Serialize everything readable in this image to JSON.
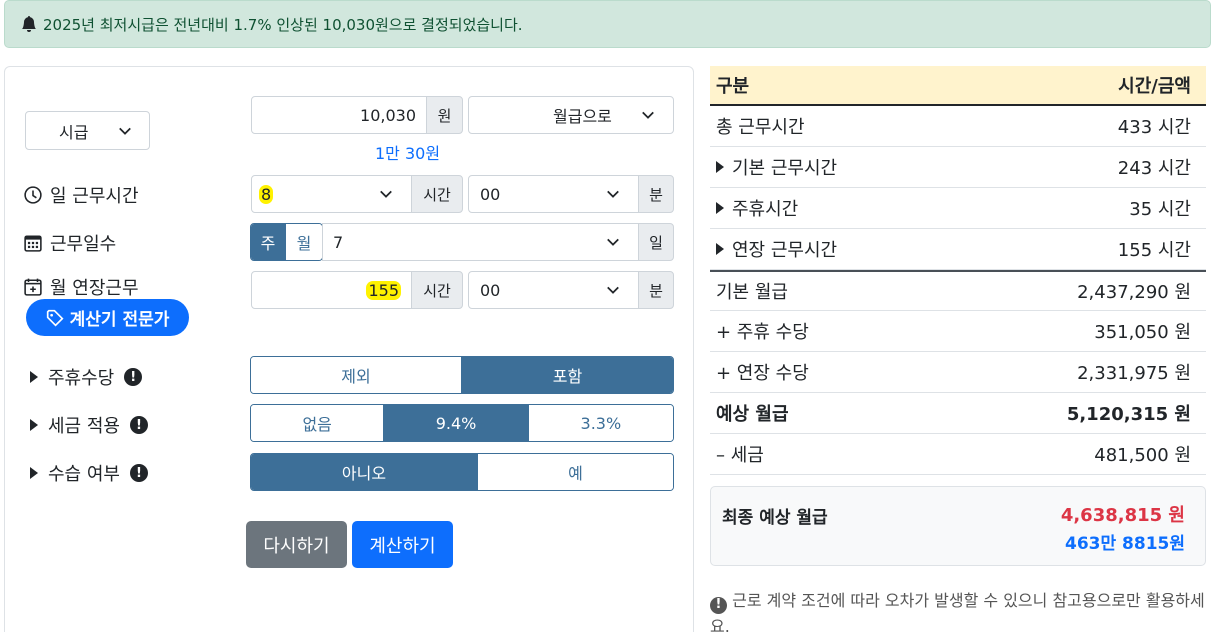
{
  "alert": {
    "text": "2025년 최저시급은 전년대비 1.7% 인상된 10,030원으로 결정되었습니다."
  },
  "form": {
    "pay_type": "시급",
    "wage_value": "10,030",
    "wage_unit": "원",
    "convert_select": "월급으로",
    "wage_korean": "1만 30원",
    "daily_hours": {
      "label": "일 근무시간",
      "hours": "8",
      "hours_unit": "시간",
      "minutes": "00",
      "minutes_unit": "분"
    },
    "work_days": {
      "label": "근무일수",
      "tab_week": "주",
      "tab_month": "월",
      "days": "7",
      "days_unit": "일"
    },
    "overtime": {
      "label": "월 연장근무",
      "hours": "155",
      "hours_unit": "시간",
      "minutes": "00",
      "minutes_unit": "분"
    },
    "expert_button": "계산기 전문가",
    "weekly_allowance": {
      "label": "주휴수당",
      "options": [
        "제외",
        "포함"
      ],
      "selected": 1
    },
    "tax": {
      "label": "세금 적용",
      "options": [
        "없음",
        "9.4%",
        "3.3%"
      ],
      "selected": 1
    },
    "probation": {
      "label": "수습 여부",
      "options": [
        "아니오",
        "예"
      ],
      "selected": 0
    },
    "reset_button": "다시하기",
    "calc_button": "계산하기"
  },
  "table": {
    "header": {
      "col1": "구분",
      "col2": "시간/금액"
    },
    "rows": [
      {
        "label": "총 근무시간",
        "value": "433 시간"
      },
      {
        "label": "기본 근무시간",
        "value": "243 시간"
      },
      {
        "label": "주휴시간",
        "value": "35 시간"
      },
      {
        "label": "연장 근무시간",
        "value": "155 시간"
      },
      {
        "label": "기본 월급",
        "value": "2,437,290 원"
      },
      {
        "label": "+ 주휴 수당",
        "value": "351,050 원"
      },
      {
        "label": "+ 연장 수당",
        "value": "2,331,975 원"
      },
      {
        "label": "예상 월급",
        "value": "5,120,315 원"
      },
      {
        "label": "– 세금",
        "value": "481,500 원"
      }
    ]
  },
  "final": {
    "label": "최종 예상 월급",
    "amount": "4,638,815 원",
    "amount_korean": "463만 8815원",
    "amount_color": "#dc3545",
    "korean_color": "#0d6efd"
  },
  "note": {
    "text": "근로 계약 조건에 따라 오차가 발생할 수 있으니 참고용으로만 활용하세요."
  },
  "colors": {
    "accent": "#3d6f98",
    "primary": "#0d6efd",
    "secondary": "#6c757d",
    "alert_bg": "#d1e7dd"
  }
}
